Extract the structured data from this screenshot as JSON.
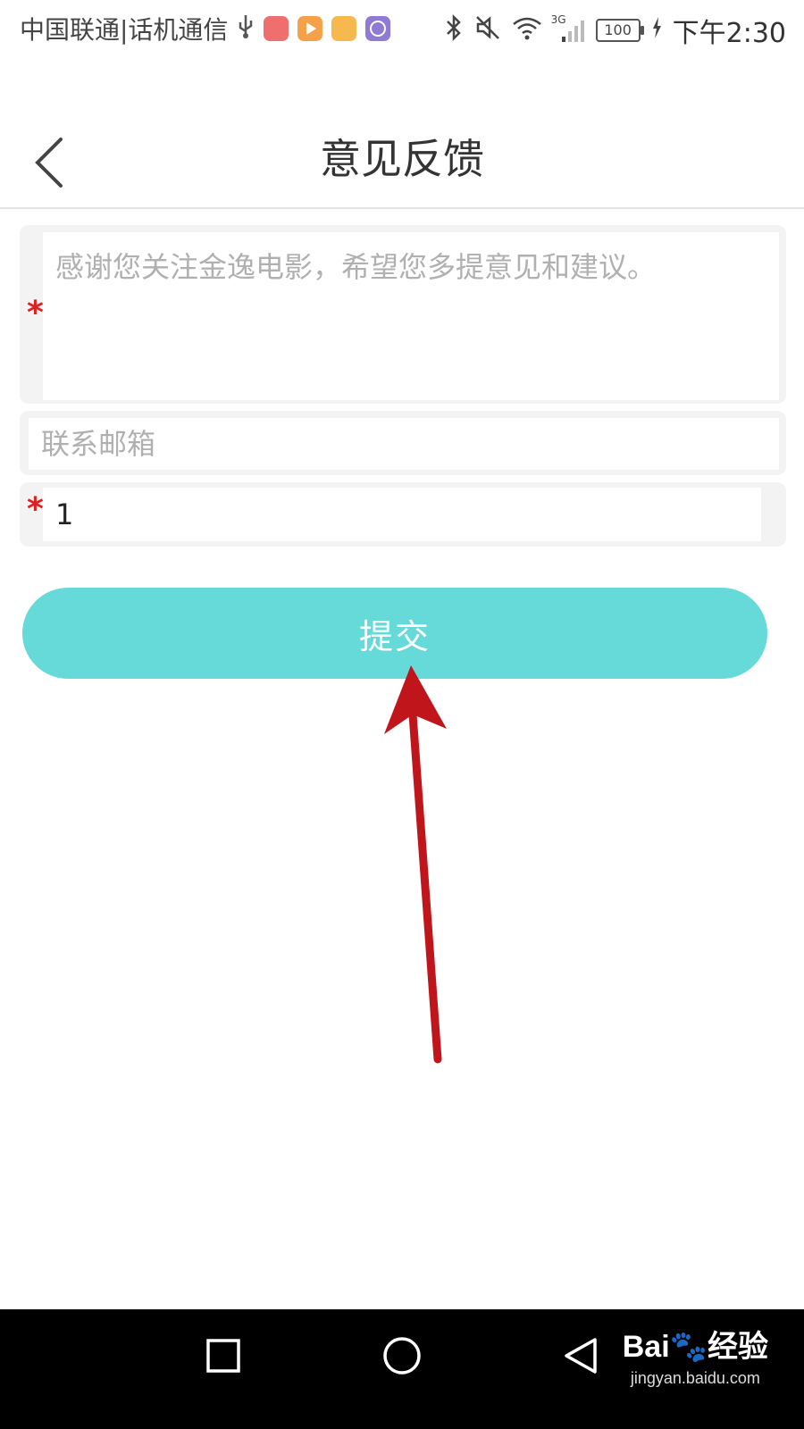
{
  "status_bar": {
    "carrier": "中国联通|话机通信",
    "time": "下午2:30",
    "battery": "100",
    "network": "3G",
    "icons": [
      "usb-icon",
      "huawei-appgallery-icon",
      "video-app-icon",
      "files-app-icon",
      "browser-app-icon",
      "bluetooth-icon",
      "mute-icon",
      "wifi-icon",
      "signal-icon",
      "charging-icon"
    ]
  },
  "header": {
    "title": "意见反馈"
  },
  "form": {
    "feedback_placeholder": "感谢您关注金逸电影，希望您多提意见和建议。",
    "email_placeholder": "联系邮箱",
    "phone_value": "1",
    "required_mark": "*"
  },
  "submit": {
    "label": "提交"
  },
  "annotation": {
    "color": "#c0161b"
  },
  "watermark": {
    "logo": "Bai🐾经验",
    "url": "jingyan.baidu.com"
  },
  "colors": {
    "accent": "#66d9d9",
    "required": "#e02020"
  }
}
